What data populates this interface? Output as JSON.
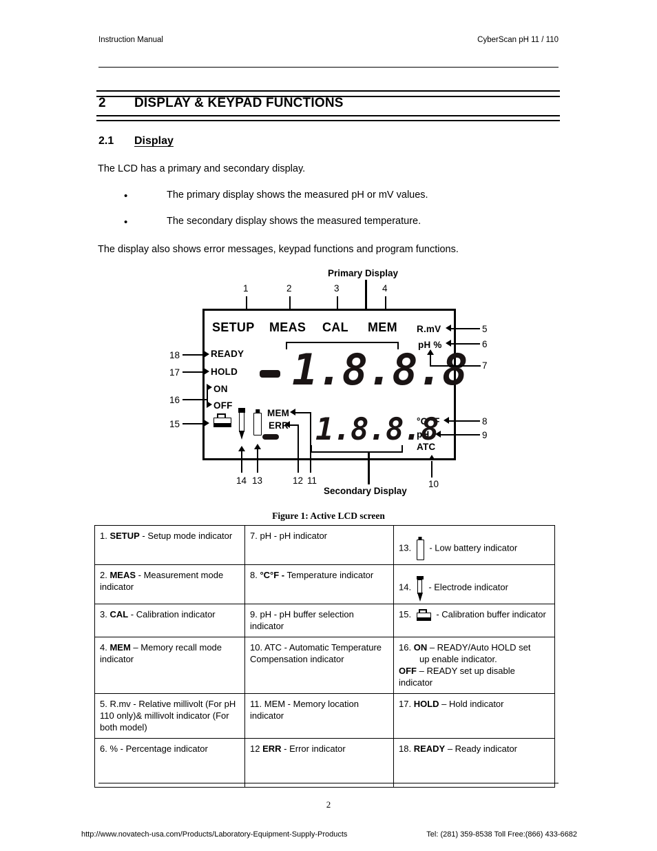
{
  "running_head": {
    "left": "Instruction Manual",
    "right": "CyberScan pH 11 / 110"
  },
  "section": {
    "number": "2",
    "title": "DISPLAY & KEYPAD FUNCTIONS"
  },
  "subsection": {
    "number": "2.1",
    "title": "Display"
  },
  "body": {
    "intro": "The LCD has a primary and secondary display.",
    "bullet1": "The primary display shows the measured pH or mV values.",
    "bullet2": "The secondary display shows the measured temperature.",
    "bullet_marker": "•",
    "outro": "The display also shows error messages, keypad functions and program functions."
  },
  "figure": {
    "caption": "Figure 1: Active LCD screen",
    "primary_display_label": "Primary Display",
    "secondary_display_label": "Secondary Display",
    "lcd": {
      "mode_labels": [
        "SETUP",
        "MEAS",
        "CAL",
        "MEM"
      ],
      "right_top": [
        "R.mV",
        "pH %"
      ],
      "right_bottom": [
        "°C °F",
        "pH",
        "ATC"
      ],
      "left_labels": [
        "READY",
        "HOLD",
        "ON",
        "OFF"
      ],
      "mem_label": "MEM",
      "err_label": "ERR",
      "primary_value": "1.8.8.8",
      "secondary_value": "1.8.8.8"
    },
    "callouts": {
      "c1": "1",
      "c2": "2",
      "c3": "3",
      "c4": "4",
      "c5": "5",
      "c6": "6",
      "c7": "7",
      "c8": "8",
      "c9": "9",
      "c10": "10",
      "c11": "11",
      "c12": "12",
      "c13": "13",
      "c14": "14",
      "c15": "15",
      "c16": "16",
      "c17": "17",
      "c18": "18"
    }
  },
  "legend": {
    "rows": [
      {
        "c1_num": "1.",
        "c1_bold": "SETUP",
        "c1_text": " - Setup mode indicator",
        "c2_num": "7.",
        "c2_bold": "",
        "c2_text": " pH - pH indicator",
        "c3_num": "13.",
        "c3_icon": "battery-icon",
        "c3_text": " - Low battery indicator"
      },
      {
        "c1_num": "2.",
        "c1_bold": "MEAS",
        "c1_text": " - Measurement mode indicator",
        "c2_num": "8.",
        "c2_bold": "°C°F -",
        "c2_text": " Temperature indicator",
        "c3_num": "14.",
        "c3_icon": "electrode-icon",
        "c3_text": " - Electrode indicator"
      },
      {
        "c1_num": "3.",
        "c1_bold": "CAL",
        "c1_text": " - Calibration indicator",
        "c2_num": "9.",
        "c2_bold": "",
        "c2_text": " pH - pH buffer selection indicator",
        "c3_num": "15.",
        "c3_icon": "calibration-buffer-icon",
        "c3_text": " - Calibration buffer indicator"
      },
      {
        "c1_num": "4.",
        "c1_bold": "MEM",
        "c1_text": " – Memory recall mode indicator",
        "c2_num": "10.",
        "c2_bold": "",
        "c2_text": " ATC - Automatic Temperature Compensation indicator",
        "c3_num": "16.",
        "c3_bold": "ON",
        "c3_text": " – READY/Auto HOLD set",
        "c3_line2": "up enable indicator.",
        "c3_bold2": "OFF",
        "c3_text2": " – READY set up disable indicator"
      },
      {
        "c1_num": "5.",
        "c1_bold": "",
        "c1_text": " R.mv - Relative millivolt (For pH 110 only)& millivolt indicator (For both model)",
        "c2_num": "11.",
        "c2_bold": "",
        "c2_text": " MEM - Memory location indicator",
        "c3_num": "17.",
        "c3_bold": "HOLD",
        "c3_text": " – Hold indicator"
      },
      {
        "c1_num": "6.",
        "c1_bold": "",
        "c1_text": " % - Percentage indicator",
        "c2_num": "12",
        "c2_bold": "ERR",
        "c2_text": " - Error indicator",
        "c3_num": "18.",
        "c3_bold": "READY",
        "c3_text": " – Ready  indicator"
      }
    ]
  },
  "footer": {
    "page_number": "2",
    "url": "http://www.novatech-usa.com/Products/Laboratory-Equipment-Supply-Products",
    "contact": "Tel: (281) 359-8538  Toll Free:(866) 433-6682"
  }
}
